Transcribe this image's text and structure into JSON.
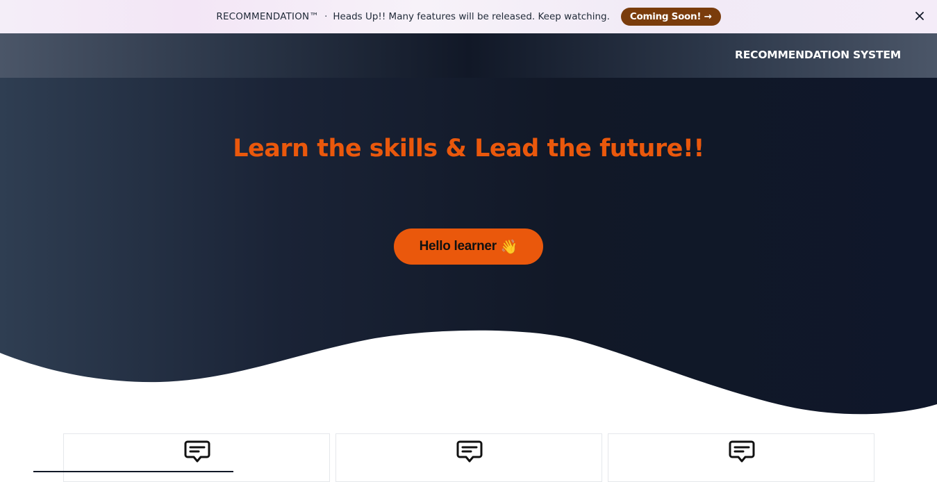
{
  "banner": {
    "brand": "RECOMMENDATION™",
    "separator": "·",
    "message": "Heads Up!! Many features will be released. Keep watching.",
    "cta_label": "Coming Soon! →",
    "close_icon": "close-icon"
  },
  "nav": {
    "logo_text": "RECOMMENDATION SYSTEM"
  },
  "hero": {
    "headline": "Learn the skills & Lead the future!!",
    "button_label": "Hello learner",
    "button_emoji": "👋"
  },
  "cards": [
    {
      "icon": "message-icon"
    },
    {
      "icon": "message-icon"
    },
    {
      "icon": "message-icon"
    }
  ],
  "colors": {
    "accent": "#ea580c",
    "cta_brown": "#7a3c0c",
    "dark_navy": "#111827",
    "slate": "#334155"
  }
}
